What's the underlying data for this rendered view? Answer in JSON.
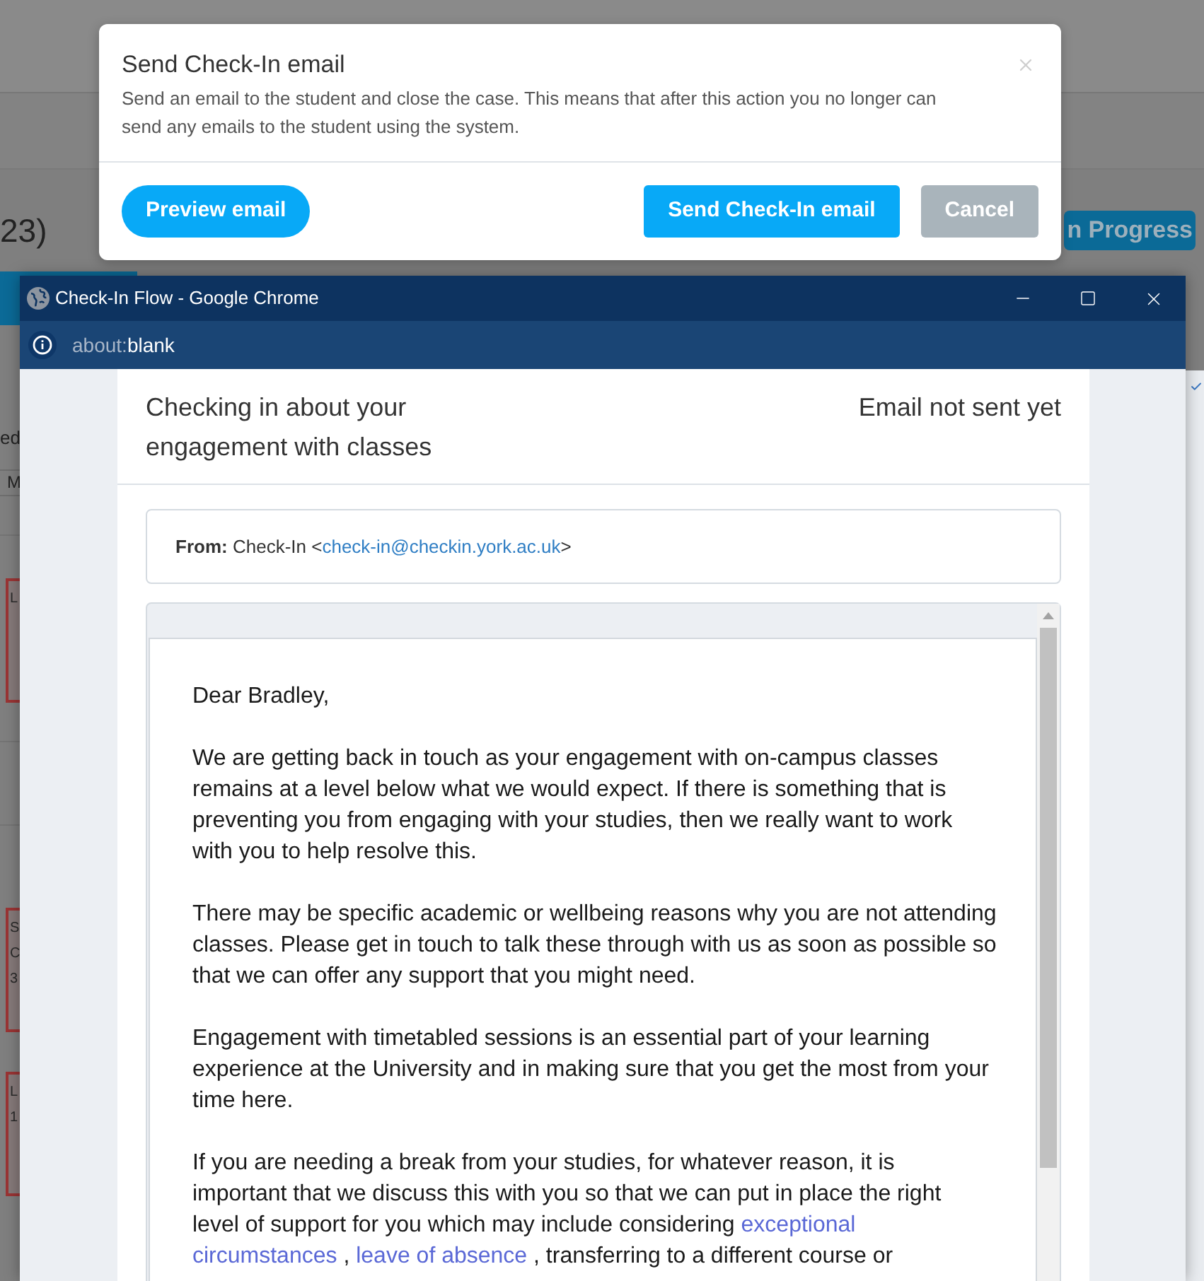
{
  "background_page": {
    "heading": "23)",
    "status_badge": "n Progress",
    "side_label": "ed",
    "column_header": "M",
    "event_cards": [
      {
        "lines": [
          "L"
        ]
      },
      {
        "lines": [
          "S",
          "C",
          "3"
        ]
      },
      {
        "lines": [
          "L",
          "1"
        ]
      }
    ]
  },
  "dialog": {
    "title": "Send Check-In email",
    "description": "Send an email to the student and close the case. This means that after this action you no longer can send any emails to the student using the system.",
    "buttons": [
      {
        "label": "Preview email",
        "kind": "secondary"
      },
      {
        "label": "Send Check-In email",
        "kind": "primary"
      },
      {
        "label": "Cancel",
        "kind": "cancel"
      }
    ]
  },
  "browser_window": {
    "title": "Check-In Flow - Google Chrome",
    "url_scheme": "about:",
    "url_path": "blank"
  },
  "email": {
    "subject": "Checking in about your engagement with classes",
    "status": "Email not sent yet",
    "sender": {
      "label": "From:",
      "name": "Check-In",
      "open": "<",
      "address": "check-in@checkin.york.ac.uk",
      "close": ">"
    },
    "greeting": "Dear Bradley,",
    "paragraphs": [
      {
        "segments": [
          {
            "kind": "text",
            "text": "We are getting back in touch as your engagement with on-campus classes\nremains at a level below what we would expect. If there is something that is\npreventing you from engaging with your studies, then we really want to work\nwith you to help resolve this."
          }
        ]
      },
      {
        "segments": [
          {
            "kind": "text",
            "text": "There may be specific academic or wellbeing reasons why you are not attending\nclasses. Please get in touch to talk these through with us as soon as possible so\nthat we can offer any support that you might need."
          }
        ]
      },
      {
        "segments": [
          {
            "kind": "text",
            "text": "Engagement with timetabled sessions is an essential part of your learning\nexperience at the University and in making sure that you get the most from your\ntime here."
          }
        ]
      },
      {
        "segments": [
          {
            "kind": "text",
            "text": "If you are needing a break from your studies, for whatever reason, it is\nimportant that we discuss this with you so that we can put in place the right\nlevel of support for you which may include considering "
          },
          {
            "kind": "link",
            "lines": [
              "exceptional",
              "circumstances"
            ]
          },
          {
            "kind": "text",
            "text": " , "
          },
          {
            "kind": "link",
            "lines": [
              "leave of absence"
            ]
          },
          {
            "kind": "text",
            "text": " , transferring to a different course or"
          }
        ]
      }
    ]
  }
}
